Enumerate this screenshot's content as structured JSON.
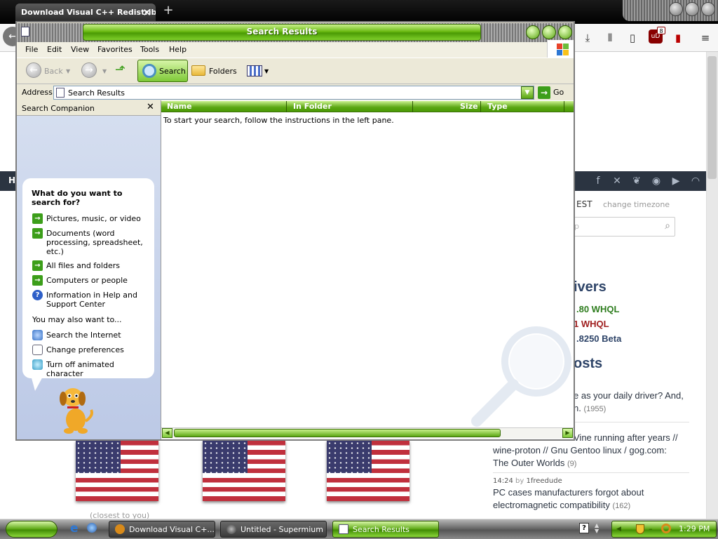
{
  "browser": {
    "tab_title": "Download Visual C++ Redistributable",
    "tab_close": "✕",
    "new_tab": "+",
    "ublock_count": "8"
  },
  "site": {
    "nav_label": "H",
    "timezone_text": "EST",
    "timezone_link": "change timezone",
    "search_placeholder": "p",
    "drivers_heading": "ivers",
    "drivers": [
      {
        "text": ".80 WHQL",
        "color": "#2e7d1e"
      },
      {
        "text": "1 WHQL",
        "color": "#a02020"
      },
      {
        "text": ".8250 Beta",
        "color": "#2e4468"
      }
    ],
    "posts_heading": "osts",
    "posts": [
      {
        "line1": "e as your daily driver? And,",
        "line2": "n.",
        "count": "(1955)"
      },
      {
        "line1": "Vine running after years //",
        "line2": "wine-proton // Gnu Gentoo linux / gog.com:",
        "line3": "The Outer Worlds",
        "count": "(9)"
      },
      {
        "time": "14:24",
        "by": "by",
        "author": "1freedude",
        "line1": "PC cases manufacturers forgot about",
        "line2": "electromagnetic compatibility",
        "count": "(162)"
      }
    ],
    "closest_text": "(closest to you)"
  },
  "window": {
    "title": "Search Results",
    "menu": [
      "File",
      "Edit",
      "View",
      "Favorites",
      "Tools",
      "Help"
    ],
    "toolbar": {
      "back": "Back",
      "search": "Search",
      "folders": "Folders"
    },
    "address_label": "Address",
    "address_value": "Search Results",
    "go_label": "Go",
    "companion_title": "Search Companion",
    "companion_close": "✕",
    "question": "What do you want to search for?",
    "options": [
      "Pictures, music, or video",
      "Documents (word processing, spreadsheet, etc.)",
      "All files and folders",
      "Computers or people",
      "Information in Help and Support Center"
    ],
    "also_label": "You may also want to...",
    "also_options": [
      "Search the Internet",
      "Change preferences",
      "Turn off animated character"
    ],
    "columns": [
      "Name",
      "In Folder",
      "Size",
      "Type"
    ],
    "empty_message": "To start your search, follow the instructions in the left pane."
  },
  "taskbar": {
    "tasks": [
      "Download Visual C+...",
      "Untitled - Supermium",
      "Search Results"
    ],
    "clock": "1:29 PM",
    "help_glyph": "?"
  }
}
